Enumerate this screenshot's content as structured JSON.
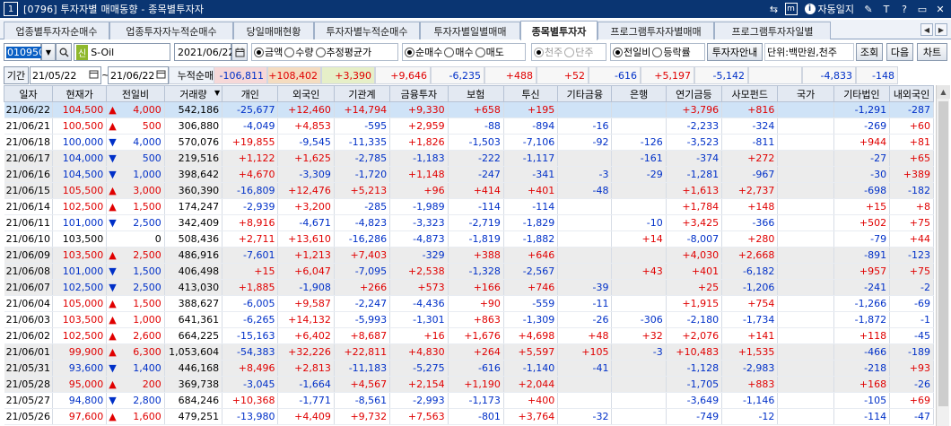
{
  "window": {
    "number": "1",
    "title": "[0796] 투자자별 매매동향 - 종목별투자자",
    "auto_label": "자동일지",
    "controls": [
      "m",
      "?",
      "T",
      "?",
      "▭",
      "✕"
    ]
  },
  "tabs": [
    "업종별투자자순매수",
    "업종투자자누적순매수",
    "당일매매현황",
    "투자자별누적순매수",
    "투자자별일별매매",
    "종목별투자자",
    "프로그램투자자별매매",
    "프로그램투자자일별"
  ],
  "active_tab": 5,
  "toolbar": {
    "code": "010950",
    "new_badge": "신",
    "stock_name": "S-Oil",
    "date": "2021/06/22",
    "radio_amount": [
      "금액",
      "수량",
      "추정평균가"
    ],
    "radio_buy": [
      "순매수",
      "매수",
      "매도"
    ],
    "radio_unit": [
      "천주",
      "단주"
    ],
    "radio_ratio": [
      "전일비",
      "등락률"
    ],
    "guide_btn": "투자자안내",
    "unit_label": "단위:백만원,천주",
    "query_btn": "조회",
    "next_btn": "다음",
    "chart_btn": "차트"
  },
  "period": {
    "label": "기간",
    "from": "21/05/22",
    "to": "21/06/22",
    "cum_label": "누적순매수",
    "cum_values": [
      "-106,811",
      "+108,402",
      "+3,390",
      "+9,646",
      "-6,235",
      "+488",
      "+52",
      "-616",
      "+5,197",
      "-5,142",
      "",
      "-4,833",
      "-148"
    ]
  },
  "columns": [
    "일자",
    "현재가",
    "전일비",
    "거래량",
    "개인",
    "외국인",
    "기관계",
    "금융투자",
    "보험",
    "투신",
    "기타금융",
    "은행",
    "연기금등",
    "사모펀드",
    "국가",
    "기타법인",
    "내외국인"
  ],
  "rows": [
    [
      "21/06/22",
      "104,500",
      "up",
      "4,000",
      "542,186",
      "-25,677",
      "+12,460",
      "+14,794",
      "+9,330",
      "+658",
      "+195",
      "",
      "",
      "+3,796",
      "+816",
      "",
      "-1,291",
      "-287"
    ],
    [
      "21/06/21",
      "100,500",
      "up",
      "500",
      "306,880",
      "-4,049",
      "+4,853",
      "-595",
      "+2,959",
      "-88",
      "-894",
      "-16",
      "",
      "-2,233",
      "-324",
      "",
      "-269",
      "+60"
    ],
    [
      "21/06/18",
      "100,000",
      "down",
      "4,000",
      "570,076",
      "+19,855",
      "-9,545",
      "-11,335",
      "+1,826",
      "-1,503",
      "-7,106",
      "-92",
      "-126",
      "-3,523",
      "-811",
      "",
      "+944",
      "+81"
    ],
    [
      "21/06/17",
      "104,000",
      "down",
      "500",
      "219,516",
      "+1,122",
      "+1,625",
      "-2,785",
      "-1,183",
      "-222",
      "-1,117",
      "",
      "-161",
      "-374",
      "+272",
      "",
      "-27",
      "+65"
    ],
    [
      "21/06/16",
      "104,500",
      "down",
      "1,000",
      "398,642",
      "+4,670",
      "-3,309",
      "-1,720",
      "+1,148",
      "-247",
      "-341",
      "-3",
      "-29",
      "-1,281",
      "-967",
      "",
      "-30",
      "+389"
    ],
    [
      "21/06/15",
      "105,500",
      "up",
      "3,000",
      "360,390",
      "-16,809",
      "+12,476",
      "+5,213",
      "+96",
      "+414",
      "+401",
      "-48",
      "",
      "+1,613",
      "+2,737",
      "",
      "-698",
      "-182"
    ],
    [
      "21/06/14",
      "102,500",
      "up",
      "1,500",
      "174,247",
      "-2,939",
      "+3,200",
      "-285",
      "-1,989",
      "-114",
      "-114",
      "",
      "",
      "+1,784",
      "+148",
      "",
      "+15",
      "+8"
    ],
    [
      "21/06/11",
      "101,000",
      "down",
      "2,500",
      "342,409",
      "+8,916",
      "-4,671",
      "-4,823",
      "-3,323",
      "-2,719",
      "-1,829",
      "",
      "-10",
      "+3,425",
      "-366",
      "",
      "+502",
      "+75"
    ],
    [
      "21/06/10",
      "103,500",
      "none",
      "0",
      "508,436",
      "+2,711",
      "+13,610",
      "-16,286",
      "-4,873",
      "-1,819",
      "-1,882",
      "",
      "+14",
      "-8,007",
      "+280",
      "",
      "-79",
      "+44"
    ],
    [
      "21/06/09",
      "103,500",
      "up",
      "2,500",
      "486,916",
      "-7,601",
      "+1,213",
      "+7,403",
      "-329",
      "+388",
      "+646",
      "",
      "",
      "+4,030",
      "+2,668",
      "",
      "-891",
      "-123"
    ],
    [
      "21/06/08",
      "101,000",
      "down",
      "1,500",
      "406,498",
      "+15",
      "+6,047",
      "-7,095",
      "+2,538",
      "-1,328",
      "-2,567",
      "",
      "+43",
      "+401",
      "-6,182",
      "",
      "+957",
      "+75"
    ],
    [
      "21/06/07",
      "102,500",
      "down",
      "2,500",
      "413,030",
      "+1,885",
      "-1,908",
      "+266",
      "+573",
      "+166",
      "+746",
      "-39",
      "",
      "+25",
      "-1,206",
      "",
      "-241",
      "-2"
    ],
    [
      "21/06/04",
      "105,000",
      "up",
      "1,500",
      "388,627",
      "-6,005",
      "+9,587",
      "-2,247",
      "-4,436",
      "+90",
      "-559",
      "-11",
      "",
      "+1,915",
      "+754",
      "",
      "-1,266",
      "-69"
    ],
    [
      "21/06/03",
      "103,500",
      "up",
      "1,000",
      "641,361",
      "-6,265",
      "+14,132",
      "-5,993",
      "-1,301",
      "+863",
      "-1,309",
      "-26",
      "-306",
      "-2,180",
      "-1,734",
      "",
      "-1,872",
      "-1"
    ],
    [
      "21/06/02",
      "102,500",
      "up",
      "2,600",
      "664,225",
      "-15,163",
      "+6,402",
      "+8,687",
      "+16",
      "+1,676",
      "+4,698",
      "+48",
      "+32",
      "+2,076",
      "+141",
      "",
      "+118",
      "-45"
    ],
    [
      "21/06/01",
      "99,900",
      "up",
      "6,300",
      "1,053,604",
      "-54,383",
      "+32,226",
      "+22,811",
      "+4,830",
      "+264",
      "+5,597",
      "+105",
      "-3",
      "+10,483",
      "+1,535",
      "",
      "-466",
      "-189"
    ],
    [
      "21/05/31",
      "93,600",
      "down",
      "1,400",
      "446,168",
      "+8,496",
      "+2,813",
      "-11,183",
      "-5,275",
      "-616",
      "-1,140",
      "-41",
      "",
      "-1,128",
      "-2,983",
      "",
      "-218",
      "+93"
    ],
    [
      "21/05/28",
      "95,000",
      "up",
      "200",
      "369,738",
      "-3,045",
      "-1,664",
      "+4,567",
      "+2,154",
      "+1,190",
      "+2,044",
      "",
      "",
      "-1,705",
      "+883",
      "",
      "+168",
      "-26"
    ],
    [
      "21/05/27",
      "94,800",
      "down",
      "2,800",
      "684,246",
      "+10,368",
      "-1,771",
      "-8,561",
      "-2,993",
      "-1,173",
      "+400",
      "",
      "",
      "-3,649",
      "-1,146",
      "",
      "-105",
      "+69"
    ],
    [
      "21/05/26",
      "97,600",
      "up",
      "1,600",
      "479,251",
      "-13,980",
      "+4,409",
      "+9,732",
      "+7,563",
      "-801",
      "+3,764",
      "-32",
      "",
      "-749",
      "-12",
      "",
      "-114",
      "-47"
    ]
  ]
}
